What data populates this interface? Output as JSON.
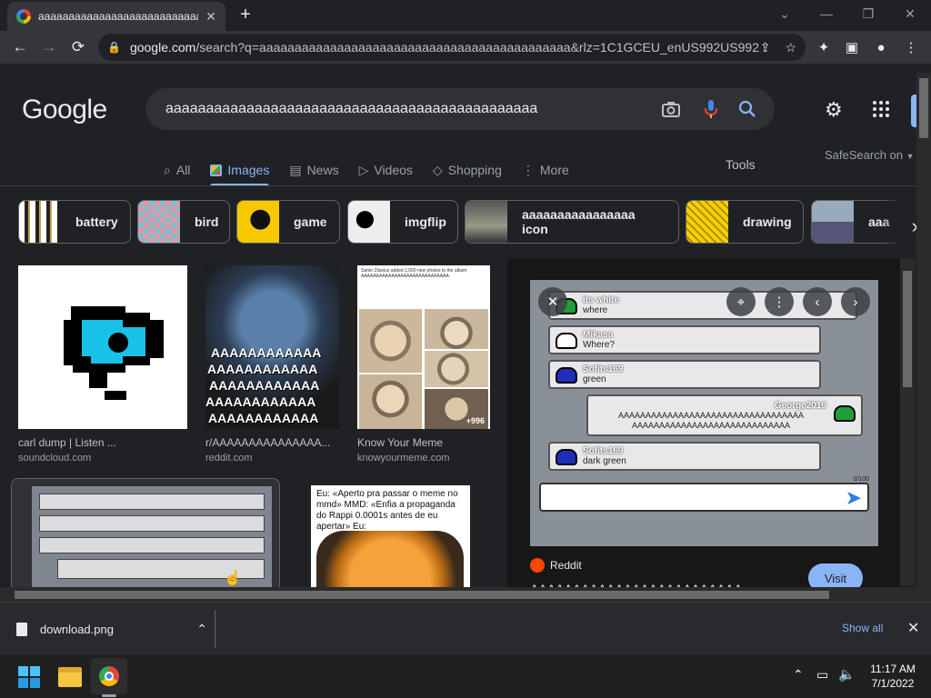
{
  "browser": {
    "tab_title": "aaaaaaaaaaaaaaaaaaaaaaaaaaaaaaaaaaa",
    "url_domain": "google.com",
    "url_rest": "/search?q=aaaaaaaaaaaaaaaaaaaaaaaaaaaaaaaaaaaaaaaaaaaa&rlz=1C1GCEU_enUS992US992..."
  },
  "search": {
    "logo": "Google",
    "query": "aaaaaaaaaaaaaaaaaaaaaaaaaaaaaaaaaaaaaaaaaaaaaa",
    "tabs": [
      "All",
      "Images",
      "News",
      "Videos",
      "Shopping",
      "More"
    ],
    "active_tab": "Images",
    "tools": "Tools",
    "safesearch": "SafeSearch on"
  },
  "chips": [
    "battery",
    "bird",
    "game",
    "imgflip",
    "aaaaaaaaaaaaaaaa icon",
    "drawing",
    "aaa"
  ],
  "results": [
    {
      "title": "carl dump | Listen ...",
      "source": "soundcloud.com"
    },
    {
      "title": "r/AAAAAAAAAAAAAAA...",
      "source": "reddit.com"
    },
    {
      "title": "Know Your Meme",
      "source": "knowyourmeme.com"
    }
  ],
  "thumbs": {
    "stitch_text": "AAAAAAAAAAAA",
    "kym_header": "Santo Zilavius added 1,000 new photos to the album AAAAAAAAAAAAAAAAAAAAAAAAAAAAA.",
    "kym_more": "+996",
    "meme_text": "Eu: «Aperto pra passar o meme no mmd» MMD: «Enfia a propaganda do Rappi 0.0001s antes de eu apertar» Eu:"
  },
  "preview": {
    "chat": [
      {
        "name": "its white",
        "text": "where",
        "color": "#1e9e3a"
      },
      {
        "name": "Mikasa",
        "text": "Where?",
        "color": "#ffffff"
      },
      {
        "name": "Sofits169",
        "text": "green",
        "color": "#1f2fb5"
      },
      {
        "name": "George2016",
        "text": "AAAAAAAAAAAAAAAAAAAAAAAAAAAAAAAAAA AAAAAAAAAAAAAAAAAAAAAAAAAAAAA",
        "color": "#1e9e3a"
      },
      {
        "name": "Sofits169",
        "text": "dark green",
        "color": "#1f2fb5"
      }
    ],
    "counter": "0/100",
    "site": "Reddit",
    "visit": "Visit",
    "caption": "AAAAAAAAAAAAAAAAAAAAAAAAA"
  },
  "download": {
    "filename": "download.png",
    "show_all": "Show all"
  },
  "taskbar": {
    "time": "11:17 AM",
    "date": "7/1/2022"
  }
}
